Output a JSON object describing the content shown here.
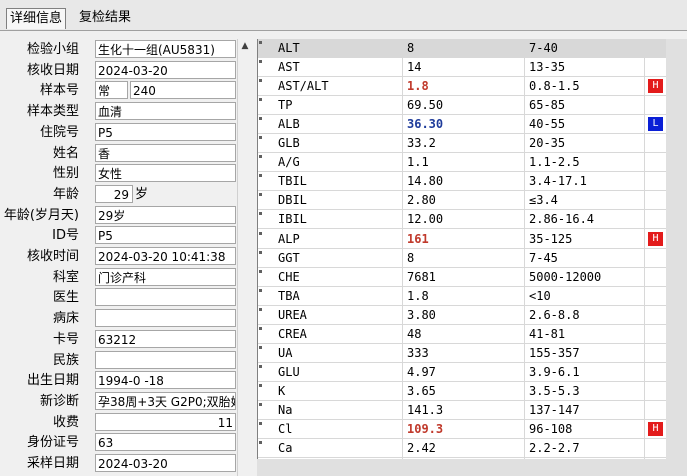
{
  "tabs": [
    {
      "label": "详细信息"
    },
    {
      "label": "复检结果"
    }
  ],
  "form": {
    "fields": [
      {
        "label": "检验小组",
        "value": "生化十一组(AU5831)"
      },
      {
        "label": "核收日期",
        "value": "2024-03-20"
      },
      {
        "label": "样本号",
        "prefix": "常",
        "value": "240"
      },
      {
        "label": "样本类型",
        "value": "血清"
      },
      {
        "label": "住院号",
        "value": "P5"
      },
      {
        "label": "姓名",
        "value": "香"
      },
      {
        "label": "性别",
        "value": "女性"
      },
      {
        "label": "年龄",
        "value": "29",
        "unit": "岁"
      },
      {
        "label": "年龄(岁月天)",
        "value": "29岁"
      },
      {
        "label": "ID号",
        "value": "P5"
      },
      {
        "label": "核收时间",
        "value": "2024-03-20 10:41:38"
      },
      {
        "label": "科室",
        "value": "门诊产科"
      },
      {
        "label": "医生",
        "value": ""
      },
      {
        "label": "病床",
        "value": ""
      },
      {
        "label": "卡号",
        "value": "63212"
      },
      {
        "label": "民族",
        "value": ""
      },
      {
        "label": "出生日期",
        "value": "1994-0 -18"
      },
      {
        "label": "新诊断",
        "value": "孕38周+3天 G2P0;双胎妊"
      },
      {
        "label": "收费",
        "value": "11"
      },
      {
        "label": "身份证号",
        "value": "63"
      },
      {
        "label": "采样日期",
        "value": "2024-03-20"
      }
    ]
  },
  "results": {
    "colors": {
      "high": "#e31b1b",
      "low": "#0a1fd6"
    },
    "rows": [
      {
        "name": "ALT",
        "value": "8",
        "ref": "7-40",
        "flag": "",
        "selected": true
      },
      {
        "name": "AST",
        "value": "14",
        "ref": "13-35",
        "flag": ""
      },
      {
        "name": "AST/ALT",
        "value": "1.8",
        "ref": "0.8-1.5",
        "flag": "H"
      },
      {
        "name": "TP",
        "value": "69.50",
        "ref": "65-85",
        "flag": ""
      },
      {
        "name": "ALB",
        "value": "36.30",
        "ref": "40-55",
        "flag": "L"
      },
      {
        "name": "GLB",
        "value": "33.2",
        "ref": "20-35",
        "flag": ""
      },
      {
        "name": "A/G",
        "value": "1.1",
        "ref": "1.1-2.5",
        "flag": ""
      },
      {
        "name": "TBIL",
        "value": "14.80",
        "ref": "3.4-17.1",
        "flag": ""
      },
      {
        "name": "DBIL",
        "value": "2.80",
        "ref": "≤3.4",
        "flag": ""
      },
      {
        "name": "IBIL",
        "value": "12.00",
        "ref": "2.86-16.4",
        "flag": ""
      },
      {
        "name": "ALP",
        "value": "161",
        "ref": "35-125",
        "flag": "H"
      },
      {
        "name": "GGT",
        "value": "8",
        "ref": "7-45",
        "flag": ""
      },
      {
        "name": "CHE",
        "value": "7681",
        "ref": "5000-12000",
        "flag": ""
      },
      {
        "name": "TBA",
        "value": "1.8",
        "ref": "<10",
        "flag": ""
      },
      {
        "name": "UREA",
        "value": "3.80",
        "ref": "2.6-8.8",
        "flag": ""
      },
      {
        "name": "CREA",
        "value": "48",
        "ref": "41-81",
        "flag": ""
      },
      {
        "name": "UA",
        "value": "333",
        "ref": "155-357",
        "flag": ""
      },
      {
        "name": "GLU",
        "value": "4.97",
        "ref": "3.9-6.1",
        "flag": ""
      },
      {
        "name": "K",
        "value": "3.65",
        "ref": "3.5-5.3",
        "flag": ""
      },
      {
        "name": "Na",
        "value": "141.3",
        "ref": "137-147",
        "flag": ""
      },
      {
        "name": "Cl",
        "value": "109.3",
        "ref": "96-108",
        "flag": "H"
      },
      {
        "name": "Ca",
        "value": "2.42",
        "ref": "2.2-2.7",
        "flag": ""
      }
    ]
  }
}
